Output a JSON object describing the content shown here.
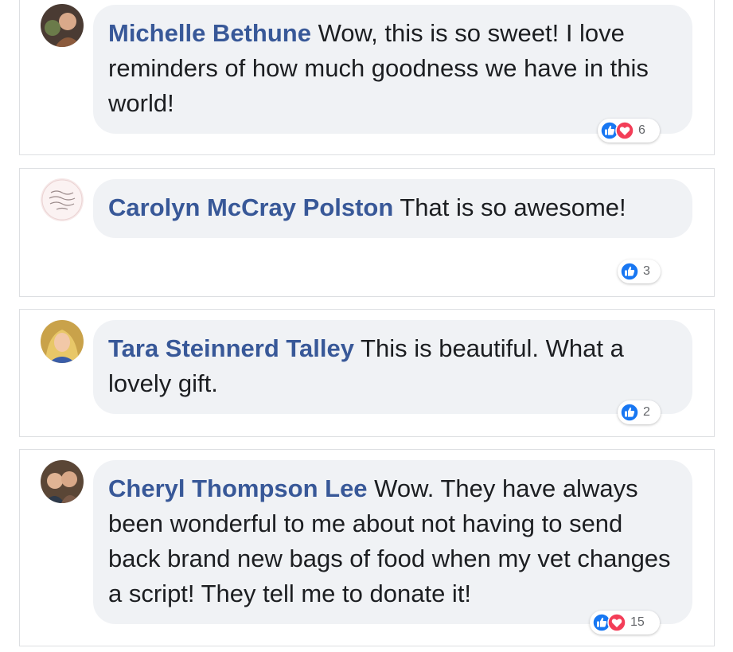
{
  "comments": [
    {
      "author": "Michelle Bethune",
      "text": "Wow, this is so sweet! I love reminders of how much goodness we have in this world!",
      "reactions": {
        "icons": [
          "like-icon",
          "love-icon"
        ],
        "count": "6"
      }
    },
    {
      "author": "Carolyn McCray Polston",
      "text": "That is so awesome!",
      "reactions": {
        "icons": [
          "like-icon"
        ],
        "count": "3"
      }
    },
    {
      "author": "Tara Steinnerd Talley",
      "text": "This is beautiful. What a lovely gift.",
      "reactions": {
        "icons": [
          "like-icon"
        ],
        "count": "2"
      }
    },
    {
      "author": "Cheryl Thompson Lee",
      "text": "Wow. They have always been wonderful to me about not having to send back brand new bags of food when my vet changes a script! They tell me to donate it!",
      "reactions": {
        "icons": [
          "like-icon",
          "love-icon"
        ],
        "count": "15"
      }
    }
  ],
  "colors": {
    "author": "#385898",
    "bubble": "#f0f2f5",
    "like": "#1877f2",
    "love": "#f33e58"
  }
}
